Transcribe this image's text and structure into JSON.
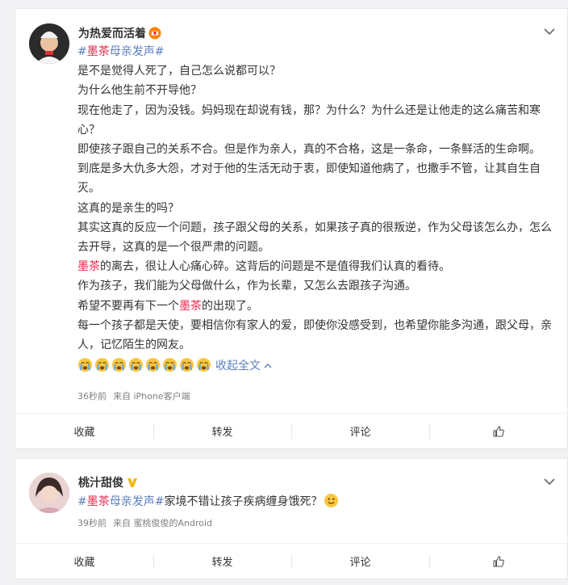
{
  "posts": [
    {
      "username": "为热爱而活着",
      "topic_prefix": "#",
      "topic_red": "墨茶",
      "topic_suffix": "母亲发声#",
      "lines": [
        "是不是觉得人死了，自己怎么说都可以？",
        "为什么他生前不开导他？",
        "现在他走了，因为没钱。妈妈现在却说有钱，那？为什么？为什么还是让他走的这么痛苦和寒心？",
        "即使孩子跟自己的关系不合。但是作为亲人，真的不合格，这是一条命，一条鲜活的生命啊。",
        "到底是多大仇多大怨，才对于他的生活无动于衷，即使知道他病了，也撒手不管，让其自生自灭。",
        "这真的是亲生的吗？",
        "其实这真的反应一个问题，孩子跟父母的关系，如果孩子真的很叛逆，作为父母该怎么办，怎么去开导，这真的是一个很严肃的问题。"
      ],
      "line_moecha_1_red": "墨茶",
      "line_moecha_1_rest": "的离去，很让人心痛心碎。这背后的问题是不是值得我们认真的看待。",
      "line_parent": "作为孩子，我们能为父母做什么，作为长辈，又怎么去跟孩子沟通。",
      "line_hope_pre": "希望不要再有下一个",
      "line_hope_red": "墨茶",
      "line_hope_post": "的出现了。",
      "line_last": "每一个孩子都是天使，要相信你有家人的爱，即使你没感受到，也希望你能多沟通，跟父母，亲人，记忆陌生的网友。",
      "emoji_name": "crying-face-icon",
      "collapse_label": "收起全文",
      "time": "36秒前",
      "source": "来自 iPhone客户端",
      "actions": {
        "favorite": "收藏",
        "repost": "转发",
        "comment": "评论"
      }
    },
    {
      "username": "桃汁甜俊",
      "topic_prefix": "#",
      "topic_red": "墨茶",
      "topic_suffix": "母亲发声#",
      "text": "家境不错让孩子疾病缠身饿死？",
      "time": "39秒前",
      "source": "来自 蜜桃俊俊的Android",
      "actions": {
        "favorite": "收藏",
        "repost": "转发",
        "comment": "评论"
      }
    }
  ],
  "colors": {
    "topic": "#5d7fbd",
    "highlight_red": "#e8264a",
    "gold_badge": "#f7b500"
  }
}
